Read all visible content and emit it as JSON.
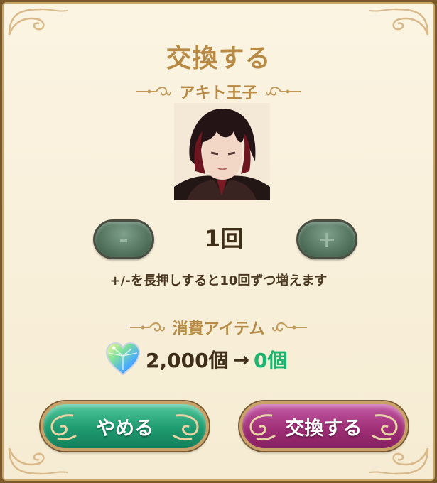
{
  "dialog": {
    "title": "交換する",
    "character_name": "アキト王子",
    "quantity": "1回",
    "minus_label": "-",
    "plus_label": "+",
    "hint": "+/-を長押しすると10回ずつ増えます",
    "cost_heading": "消費アイテム",
    "cost_amount": "2,000個",
    "cost_arrow": "→",
    "cost_remaining": "0個",
    "cancel_label": "やめる",
    "exchange_label": "交換する"
  },
  "colors": {
    "panel_bg": "#f6ecd3",
    "gold_text": "#b78a45",
    "remaining_green": "#1bb56f",
    "cancel_button": "#1f9b70",
    "exchange_button": "#a03077"
  }
}
